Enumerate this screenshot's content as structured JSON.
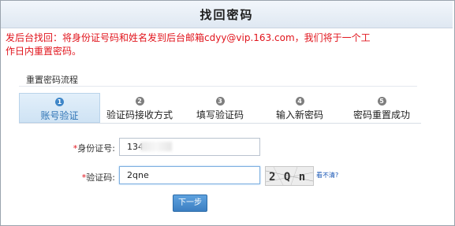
{
  "header": {
    "title": "找回密码"
  },
  "notice": {
    "text": "发后台找回：将身份证号码和姓名发到后台邮箱cdyy@vip.163.com，我们将于一个工作日内重置密码。"
  },
  "process": {
    "label": "重置密码流程",
    "steps": [
      {
        "num": "1",
        "label": "账号验证",
        "active": true
      },
      {
        "num": "2",
        "label": "验证码接收方式"
      },
      {
        "num": "3",
        "label": "填写验证码"
      },
      {
        "num": "4",
        "label": "输入新密码"
      },
      {
        "num": "5",
        "label": "密码重置成功"
      }
    ]
  },
  "form": {
    "id_label": "身份证号:",
    "id_value": "134",
    "captcha_label": "验证码:",
    "captcha_value": "2qne",
    "captcha_image_text": "2 Q n E",
    "captcha_refresh": "看不清?",
    "required_mark": "*",
    "submit_label": "下一步"
  },
  "colors": {
    "notice_text": "#e1141c",
    "active_step": "#2f74b5",
    "button": "#3c7fc2"
  }
}
